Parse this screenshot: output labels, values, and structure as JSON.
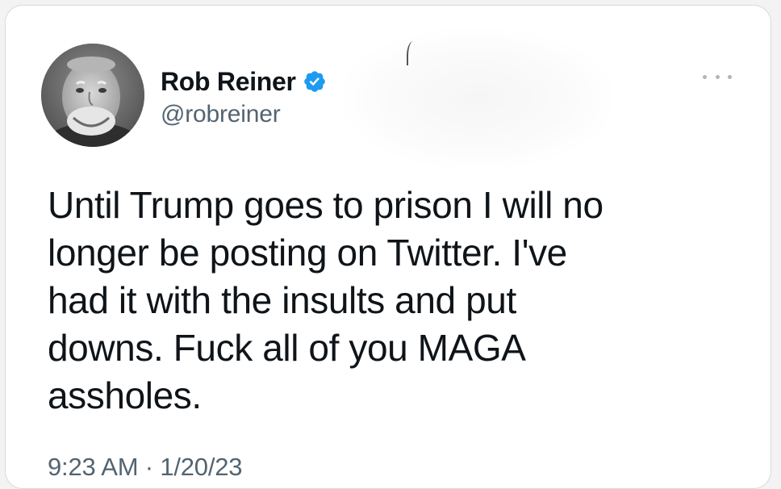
{
  "tweet": {
    "author": {
      "display_name": "Rob Reiner",
      "handle": "@robreiner",
      "verified": true,
      "avatar_icon": "profile-photo",
      "verified_icon": "verified-badge-icon",
      "verified_color": "#1d9bf0"
    },
    "text": "Until Trump goes to prison I will no\nlonger be posting on Twitter. I've\nhad it with the insults and put\ndowns. Fuck all of you MAGA\nassholes.",
    "time": "9:23 AM",
    "separator": "·",
    "date": "1/20/23",
    "more_icon": "more-options-icon"
  }
}
